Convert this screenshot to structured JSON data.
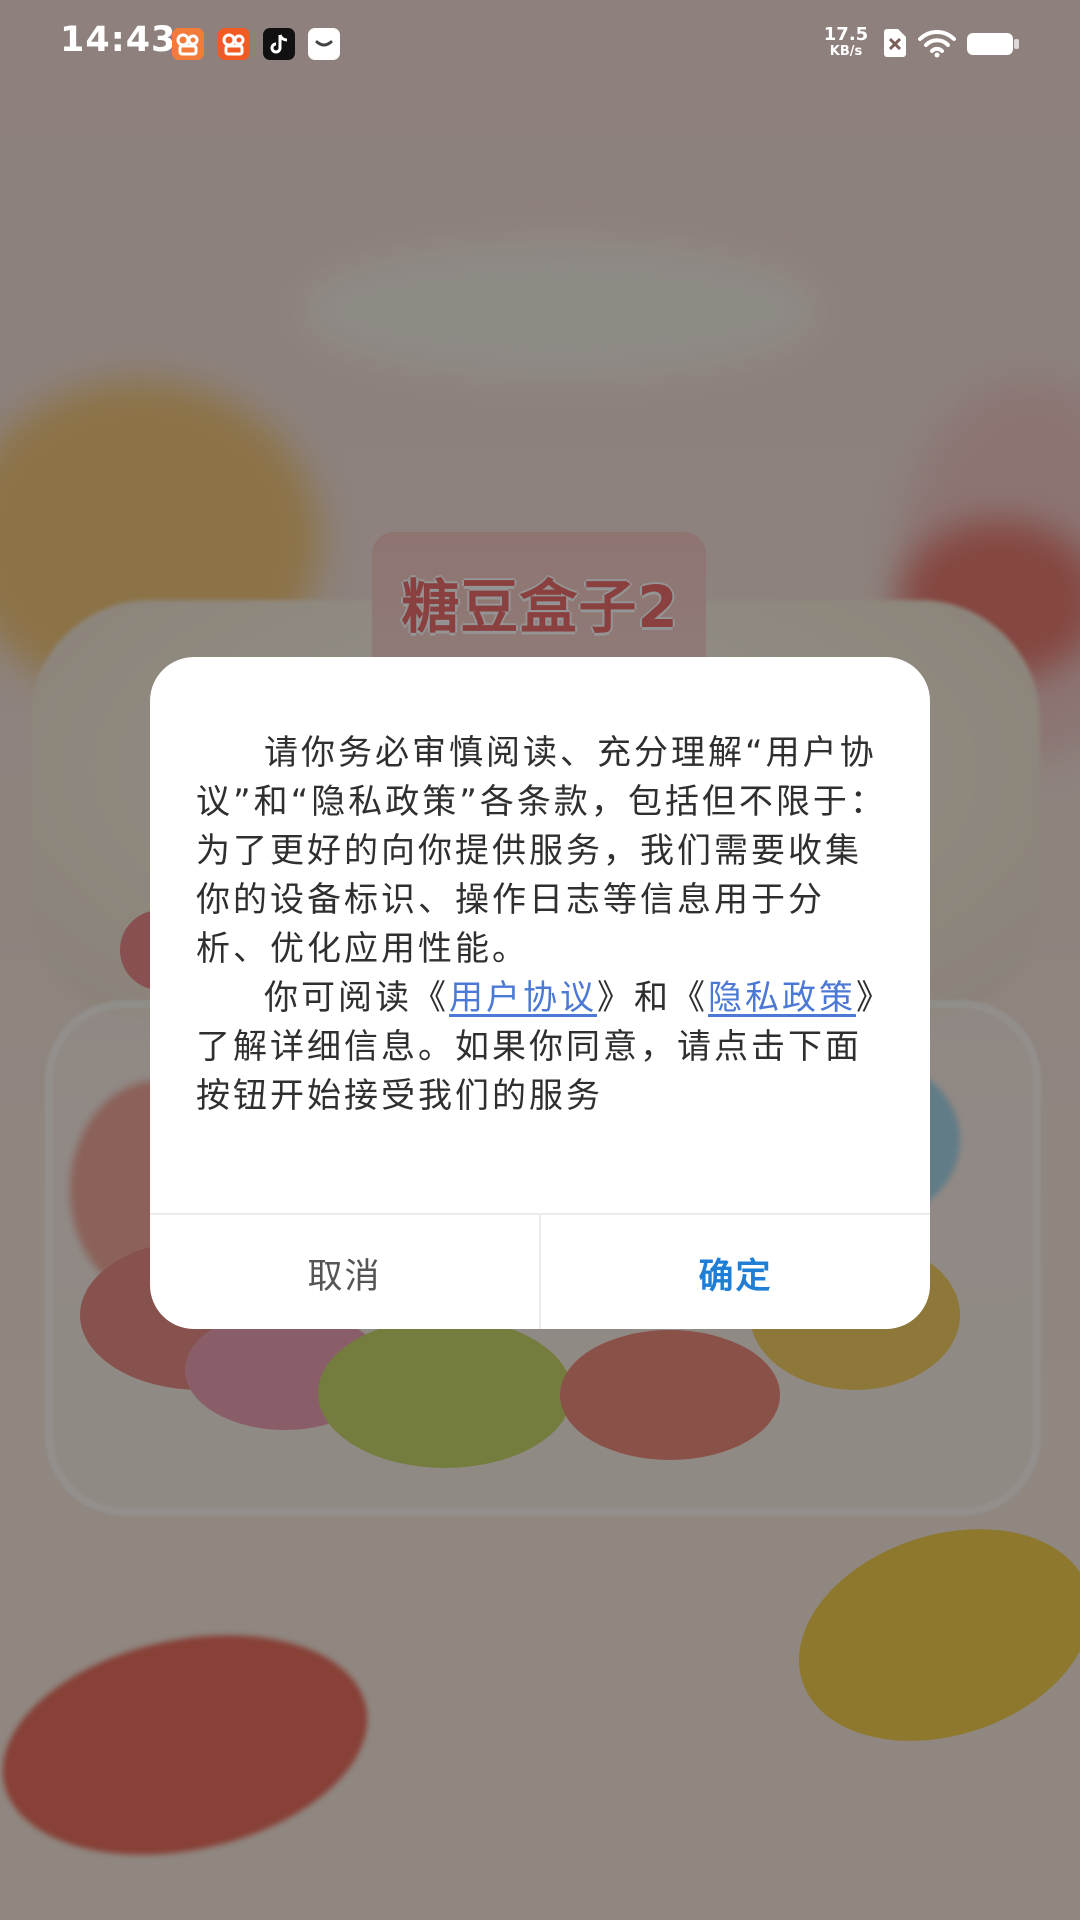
{
  "status_bar": {
    "time": "14:43",
    "net_speed_value": "17.5",
    "net_speed_unit": "KB/s",
    "notification_icons": [
      "kuaishou-icon",
      "kuaishou-speed-icon",
      "tiktok-icon",
      "message-icon"
    ],
    "right_icons": [
      "no-sim-icon",
      "wifi-icon",
      "battery-icon"
    ]
  },
  "background": {
    "app_logo": "糖豆盒子2"
  },
  "dialog": {
    "para1": "请你务必审慎阅读、充分理解“用户协议”和“隐私政策”各条款，包括但不限于：为了更好的向你提供服务，我们需要收集你的设备标识、操作日志等信息用于分析、优化应用性能。",
    "para2_prefix": "你可阅读《",
    "user_agreement_link": "用户协议",
    "para2_mid": "》和《",
    "privacy_policy_link": "隐私政策",
    "para2_suffix": "》了解详细信息。如果你同意，请点击下面按钮开始接受我们的服务",
    "cancel_label": "取消",
    "confirm_label": "确定"
  },
  "colors": {
    "link": "#4d79d6",
    "confirm": "#1f7fd6",
    "overlay": "rgba(0,0,0,0.42)"
  }
}
